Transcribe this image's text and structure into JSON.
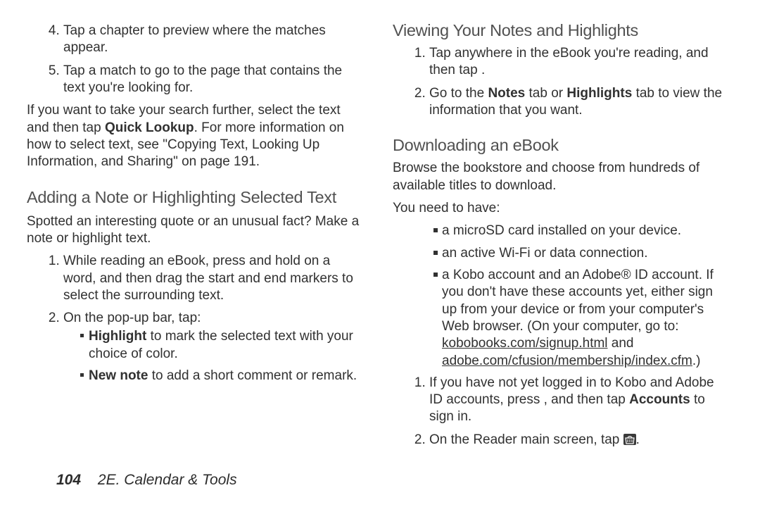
{
  "leftColumn": {
    "continuedList": {
      "item4": "Tap a chapter to preview where the matches appear.",
      "item5": "Tap a match to go to the page that contains the text you're looking for."
    },
    "quickLookup": {
      "prefix": "If you want to take your search further, select the text and then tap ",
      "bold": "Quick Lookup",
      "suffix": ". For more information on how to select text, see \"Copying Text, Looking Up Information, and Sharing\" on page 191."
    },
    "headingAdd": "Adding a Note or Highlighting Selected Text",
    "addIntro": "Spotted an interesting quote or an unusual fact? Make a note or highlight text.",
    "addList": {
      "item1": "While reading an eBook, press and hold on a word, and then drag the start and end markers to select the surrounding text.",
      "item2": "On the pop-up bar, tap:"
    },
    "addSub": {
      "highlightBold": "Highlight",
      "highlightRest": " to mark the selected text with your choice of color.",
      "newNoteBold": "New note",
      "newNoteRest": " to add a short comment or remark."
    }
  },
  "rightColumn": {
    "headingView": "Viewing Your Notes and Highlights",
    "viewList": {
      "item1": "Tap anywhere in the eBook you're reading, and then tap .",
      "item2pre": "Go to the ",
      "item2b1": "Notes",
      "item2mid": " tab or ",
      "item2b2": "Highlights",
      "item2suf": " tab to view the information that you want."
    },
    "headingDl": "Downloading an eBook",
    "dlIntro": "Browse the bookstore and choose from hundreds of available titles to download.",
    "dlNeed": "You need to have:",
    "dlBul": {
      "sd": "a microSD card installed on your device.",
      "wifi": "an active Wi-Fi or data connection.",
      "koboPre": "a Kobo account and an Adobe® ID account. If you don't have these accounts yet, either sign up from your device or from your computer's Web browser. (On your computer, go to: ",
      "link1": "kobobooks.com/signup.html",
      "koboMid": " and ",
      "link2": "adobe.com/cfusion/membership/index.cfm",
      "koboSuf": ".)"
    },
    "dlList": {
      "item1pre": "If you have not yet logged in to Kobo and Adobe ID accounts, press , and then tap ",
      "item1b": "Accounts",
      "item1suf": " to sign in.",
      "item2": "On the Reader main screen, tap "
    }
  },
  "footer": {
    "pageNum": "104",
    "section": "2E. Calendar & Tools"
  }
}
